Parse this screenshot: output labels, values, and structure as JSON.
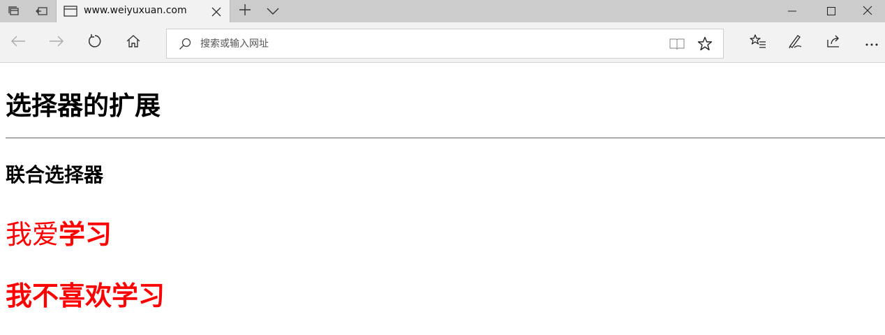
{
  "browser": {
    "tab": {
      "title": "www.weiyuxuan.com"
    },
    "address_bar": {
      "placeholder": "搜索或输入网址",
      "value": ""
    },
    "icons": {
      "set_aside_tabs": "tab-set-aside-icon",
      "show_set_aside": "tabs-aside-icon",
      "tab_page": "page-icon",
      "tab_close": "close-icon",
      "new_tab": "plus-icon",
      "tab_preview": "chevron-down-icon",
      "minimize": "minimize-icon",
      "maximize": "maximize-icon",
      "close_window": "close-icon",
      "back": "back-arrow-icon",
      "forward": "forward-arrow-icon",
      "refresh": "refresh-icon",
      "home": "home-icon",
      "search": "search-icon",
      "reading_view": "book-icon",
      "favorite": "star-icon",
      "favorites_hub": "favorites-list-icon",
      "notes": "pen-icon",
      "share": "share-icon",
      "more": "more-icon"
    },
    "colors": {
      "tab_strip": "#cccccc",
      "toolbar": "#f2f2f2",
      "accent_text": "#ff0000"
    }
  },
  "page": {
    "heading": "选择器的扩展",
    "subheading": "联合选择器",
    "line1": {
      "normal": "我爱",
      "bold": "学习"
    },
    "line2": "我不喜欢学习"
  }
}
